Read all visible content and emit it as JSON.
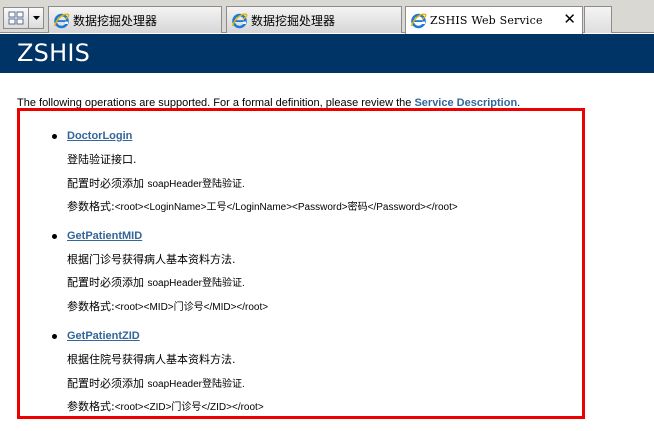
{
  "browser": {
    "tabs": [
      {
        "label": "数据挖掘处理器",
        "active": false
      },
      {
        "label": "数据挖掘处理器",
        "active": false
      },
      {
        "label": "ZSHIS Web Service",
        "active": true
      }
    ],
    "close_glyph": "✕"
  },
  "page": {
    "service_name": "ZSHIS",
    "intro_text": "The following operations are supported. For a formal definition, please review the ",
    "service_description_link": "Service Description",
    "intro_suffix": "."
  },
  "operations": [
    {
      "name": "DoctorLogin",
      "description": "登陆验证接口.",
      "config_prefix": "配置时必须添加",
      "config_header": "soapHeader登陆验证.",
      "format_prefix": "参数格式:",
      "format_value": "<root><LoginName>工号</LoginName><Password>密码</Password></root>"
    },
    {
      "name": "GetPatientMID",
      "description": "根据门诊号获得病人基本资料方法.",
      "config_prefix": "配置时必须添加",
      "config_header": "soapHeader登陆验证.",
      "format_prefix": "参数格式:",
      "format_value": "<root><MID>门诊号</MID></root>"
    },
    {
      "name": "GetPatientZID",
      "description": "根据住院号获得病人基本资料方法.",
      "config_prefix": "配置时必须添加",
      "config_header": "soapHeader登陆验证.",
      "format_prefix": "参数格式:",
      "format_value": "<root><ZID>门诊号</ZID></root>"
    }
  ],
  "colors": {
    "header_band": "#003366",
    "link": "#336699",
    "highlight_border": "#ee0000"
  },
  "icons": {
    "quick_tabs": "quick-tabs-icon",
    "tab_list": "chevron-down-icon",
    "tab_favicon": "ie-icon",
    "close": "close-icon"
  }
}
